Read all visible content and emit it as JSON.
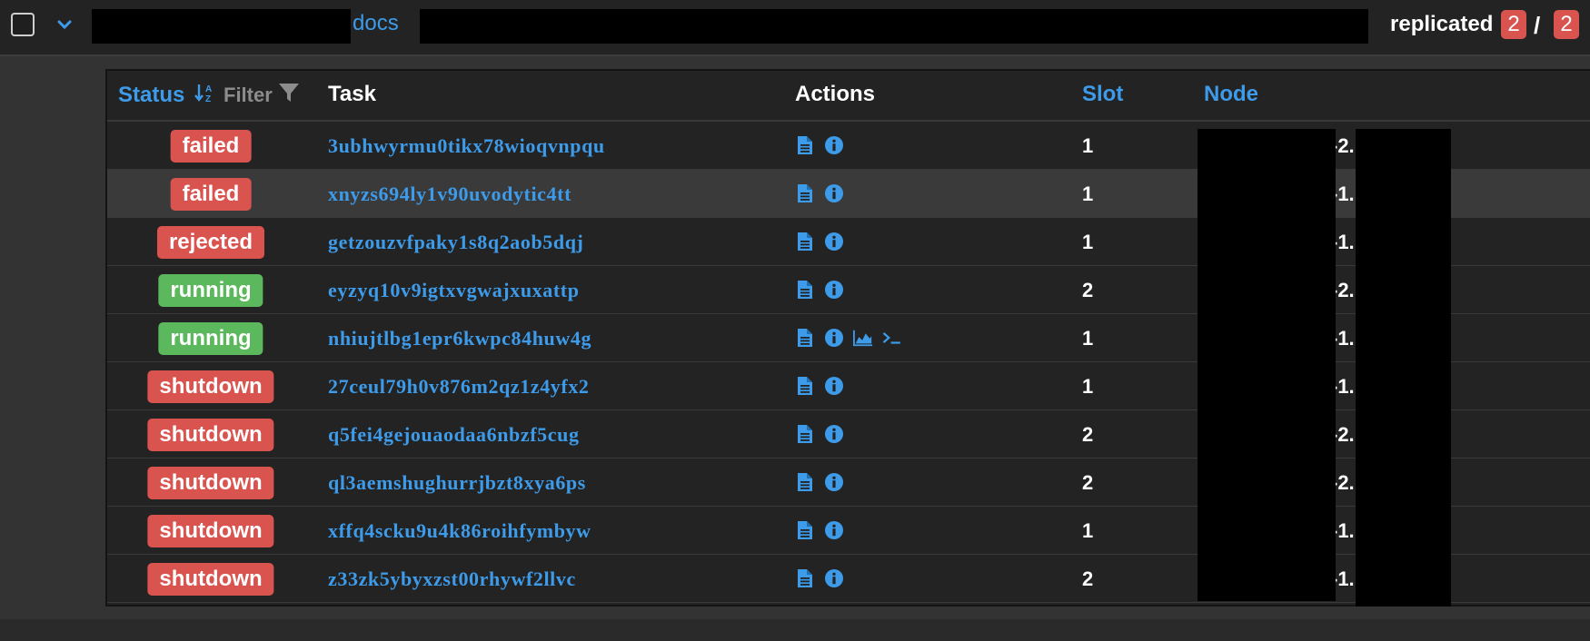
{
  "header": {
    "service_name_suffix": "docs",
    "mode_label": "replicated",
    "running_count": "2",
    "separator": "/",
    "desired_count": "2"
  },
  "table": {
    "columns": {
      "status": "Status",
      "filter": "Filter",
      "task": "Task",
      "actions": "Actions",
      "slot": "Slot",
      "node": "Node"
    },
    "rows": [
      {
        "status": "failed",
        "status_color": "#d9534f",
        "task": "3ubhwyrmu0tikx78wioqvnpqu",
        "slot": "1",
        "node": "-2."
      },
      {
        "status": "failed",
        "status_color": "#d9534f",
        "task": "xnyzs694ly1v90uvodytic4tt",
        "slot": "1",
        "node": "-1."
      },
      {
        "status": "rejected",
        "status_color": "#d9534f",
        "task": "getzouzvfpaky1s8q2aob5dqj",
        "slot": "1",
        "node": "-1."
      },
      {
        "status": "running",
        "status_color": "#5cb85c",
        "task": "eyzyq10v9igtxvgwajxuxattp",
        "slot": "2",
        "node": "-2."
      },
      {
        "status": "running",
        "status_color": "#5cb85c",
        "task": "nhiujtlbg1epr6kwpc84huw4g",
        "slot": "1",
        "node": "-1."
      },
      {
        "status": "shutdown",
        "status_color": "#d9534f",
        "task": "27ceul79h0v876m2qz1z4yfx2",
        "slot": "1",
        "node": "-1."
      },
      {
        "status": "shutdown",
        "status_color": "#d9534f",
        "task": "q5fei4gejouaodaa6nbzf5cug",
        "slot": "2",
        "node": "-2."
      },
      {
        "status": "shutdown",
        "status_color": "#d9534f",
        "task": "ql3aemshughurrjbzt8xya6ps",
        "slot": "2",
        "node": "-2."
      },
      {
        "status": "shutdown",
        "status_color": "#d9534f",
        "task": "xffq4scku9u4k86roihfymbyw",
        "slot": "1",
        "node": "-1."
      },
      {
        "status": "shutdown",
        "status_color": "#d9534f",
        "task": "z33zk5ybyxzst00rhywf2llvc",
        "slot": "2",
        "node": "-1."
      }
    ]
  },
  "icons": {
    "logs": "file-text-icon",
    "info": "info-circle-icon",
    "stats": "area-chart-icon",
    "console": "terminal-icon",
    "sort": "sort-alpha-icon",
    "filter": "filter-funnel-icon",
    "expand": "chevron-down-icon"
  },
  "colors": {
    "accent": "#3d9be9",
    "danger": "#d9534f",
    "success": "#5cb85c"
  }
}
